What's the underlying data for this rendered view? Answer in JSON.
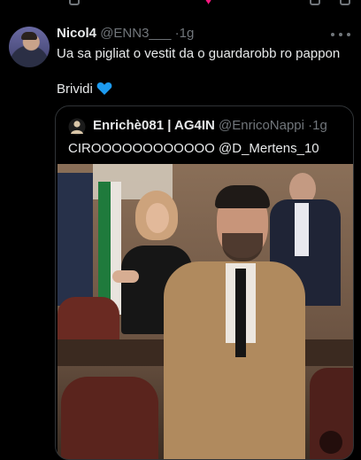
{
  "tweet": {
    "author_name": "Nicol4",
    "author_handle": "@ENN3___",
    "separator": "·",
    "age": "1g",
    "text_line1": "Ua sa pigliat o vestit da o guardarobb ro pappon",
    "text_line2": "Brividi",
    "heart_emoji": "blue-heart"
  },
  "quoted": {
    "author_name": "Enrichè081 | AG4IN",
    "author_handle": "@EnricoNappi",
    "separator": "·",
    "age": "1g",
    "text": "CIROOOOOOOOOOOO @D_Mertens_10",
    "media_type": "video"
  },
  "colors": {
    "background": "#000000",
    "text": "#e7e9ea",
    "muted": "#71767b",
    "accent_blue": "#1d9bf0",
    "border": "#2f3336"
  }
}
